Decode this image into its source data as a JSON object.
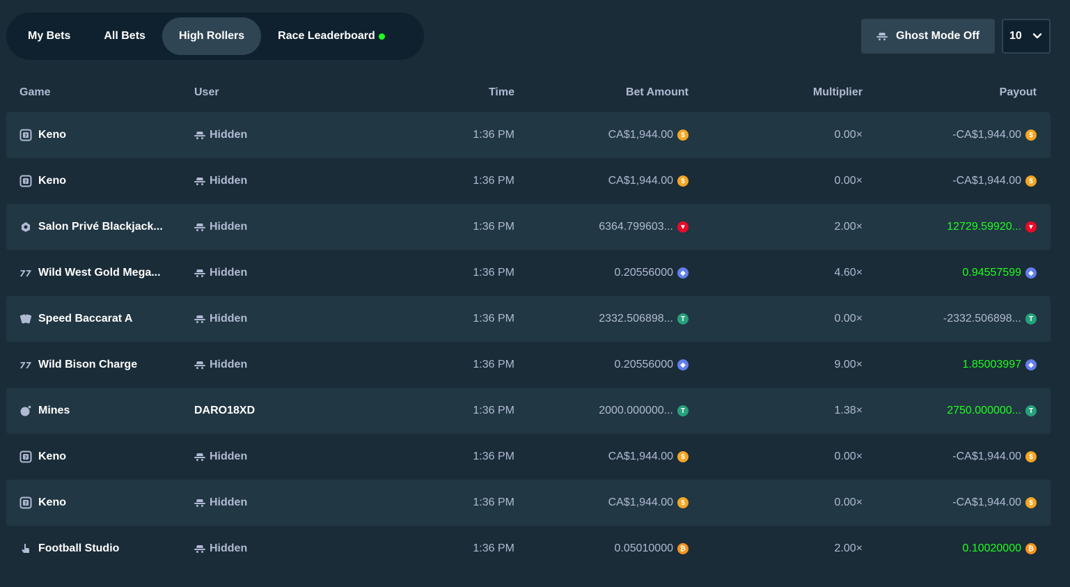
{
  "tabs": [
    {
      "label": "My Bets",
      "active": false
    },
    {
      "label": "All Bets",
      "active": false
    },
    {
      "label": "High Rollers",
      "active": true
    },
    {
      "label": "Race Leaderboard",
      "active": false,
      "live": true
    }
  ],
  "ghost_mode": {
    "label": "Ghost Mode Off",
    "icon": "ghost-hat-icon"
  },
  "count_select": {
    "value": "10"
  },
  "columns": {
    "game": "Game",
    "user": "User",
    "time": "Time",
    "bet_amount": "Bet Amount",
    "multiplier": "Multiplier",
    "payout": "Payout"
  },
  "colors": {
    "background": "#1a2c38",
    "row_alt": "#213743",
    "tab_bar": "#0f212e",
    "active_tab": "#2f4553",
    "positive_payout": "#1fff20",
    "muted_text": "#b1bad3",
    "coin_cad": "#f5a623",
    "coin_tron": "#ec0928",
    "coin_eth": "#627eea",
    "coin_usdt": "#26a17b",
    "coin_btc": "#f7931a"
  },
  "rows": [
    {
      "game": "Keno",
      "game_icon": "keno-icon",
      "user": "Hidden",
      "hidden": true,
      "time": "1:36 PM",
      "bet": "CA$1,944.00",
      "bet_coin": "cad",
      "multiplier": "0.00×",
      "payout": "-CA$1,944.00",
      "payout_coin": "cad",
      "win": false
    },
    {
      "game": "Keno",
      "game_icon": "keno-icon",
      "user": "Hidden",
      "hidden": true,
      "time": "1:36 PM",
      "bet": "CA$1,944.00",
      "bet_coin": "cad",
      "multiplier": "0.00×",
      "payout": "-CA$1,944.00",
      "payout_coin": "cad",
      "win": false
    },
    {
      "game": "Salon Privé Blackjack...",
      "game_icon": "live-dealer-icon",
      "user": "Hidden",
      "hidden": true,
      "time": "1:36 PM",
      "bet": "6364.799603...",
      "bet_coin": "tron",
      "multiplier": "2.00×",
      "payout": "12729.59920...",
      "payout_coin": "tron",
      "win": true
    },
    {
      "game": "Wild West Gold Mega...",
      "game_icon": "slots-icon",
      "user": "Hidden",
      "hidden": true,
      "time": "1:36 PM",
      "bet": "0.20556000",
      "bet_coin": "eth",
      "multiplier": "4.60×",
      "payout": "0.94557599",
      "payout_coin": "eth",
      "win": true
    },
    {
      "game": "Speed Baccarat A",
      "game_icon": "cards-icon",
      "user": "Hidden",
      "hidden": true,
      "time": "1:36 PM",
      "bet": "2332.506898...",
      "bet_coin": "usdt",
      "multiplier": "0.00×",
      "payout": "-2332.506898...",
      "payout_coin": "usdt",
      "win": false
    },
    {
      "game": "Wild Bison Charge",
      "game_icon": "slots-icon",
      "user": "Hidden",
      "hidden": true,
      "time": "1:36 PM",
      "bet": "0.20556000",
      "bet_coin": "eth",
      "multiplier": "9.00×",
      "payout": "1.85003997",
      "payout_coin": "eth",
      "win": true
    },
    {
      "game": "Mines",
      "game_icon": "mines-icon",
      "user": "DARO18XD",
      "hidden": false,
      "time": "1:36 PM",
      "bet": "2000.000000...",
      "bet_coin": "usdt",
      "multiplier": "1.38×",
      "payout": "2750.000000...",
      "payout_coin": "usdt",
      "win": true
    },
    {
      "game": "Keno",
      "game_icon": "keno-icon",
      "user": "Hidden",
      "hidden": true,
      "time": "1:36 PM",
      "bet": "CA$1,944.00",
      "bet_coin": "cad",
      "multiplier": "0.00×",
      "payout": "-CA$1,944.00",
      "payout_coin": "cad",
      "win": false
    },
    {
      "game": "Keno",
      "game_icon": "keno-icon",
      "user": "Hidden",
      "hidden": true,
      "time": "1:36 PM",
      "bet": "CA$1,944.00",
      "bet_coin": "cad",
      "multiplier": "0.00×",
      "payout": "-CA$1,944.00",
      "payout_coin": "cad",
      "win": false
    },
    {
      "game": "Football Studio",
      "game_icon": "hand-pointer-icon",
      "user": "Hidden",
      "hidden": true,
      "time": "1:36 PM",
      "bet": "0.05010000",
      "bet_coin": "btc",
      "multiplier": "2.00×",
      "payout": "0.10020000",
      "payout_coin": "btc",
      "win": true
    }
  ]
}
